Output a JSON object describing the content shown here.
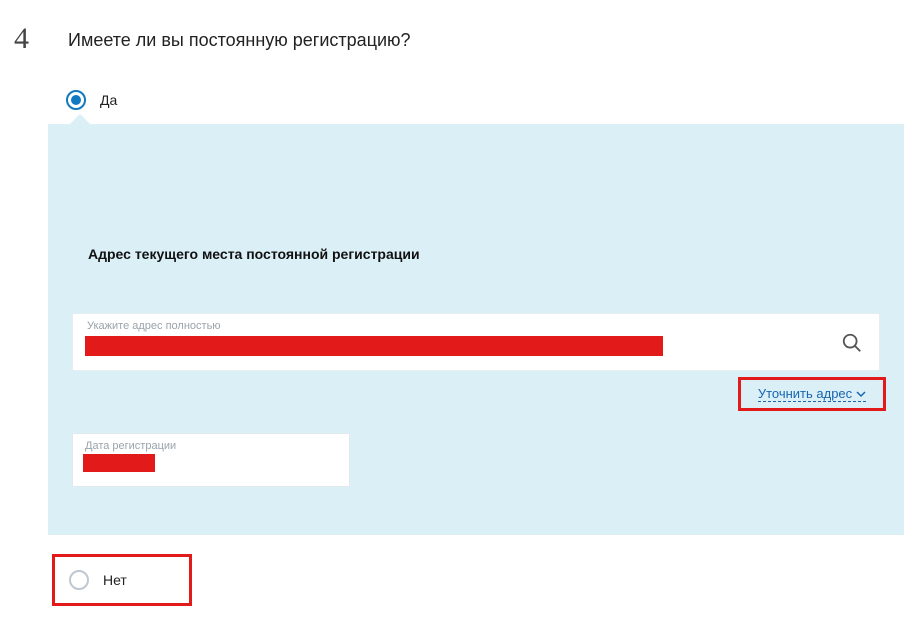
{
  "step": {
    "number": "4",
    "title": "Имеете ли вы постоянную регистрацию?"
  },
  "radios": {
    "yes": {
      "label": "Да",
      "selected": true
    },
    "no": {
      "label": "Нет",
      "selected": false
    }
  },
  "panel": {
    "heading": "Адрес текущего места постоянной регистрации",
    "address_field": {
      "placeholder": "Укажите адрес полностью",
      "value_redacted": true
    },
    "refine_link": "Уточнить адрес",
    "date_field": {
      "placeholder": "Дата регистрации",
      "value_redacted": true
    }
  },
  "highlight_boxes": [
    "refine-address",
    "radio-no"
  ]
}
